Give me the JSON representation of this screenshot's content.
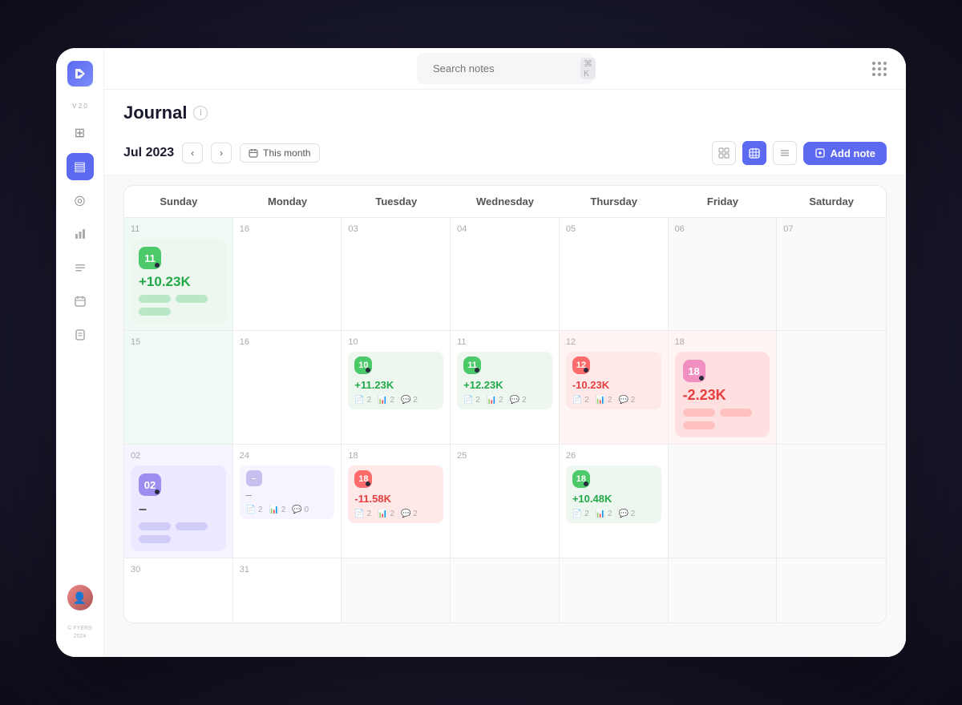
{
  "app": {
    "title": "Journal",
    "logo_letter": "D",
    "version": "V 2.0",
    "footer": "© FYERS\n2024"
  },
  "topbar": {
    "search_placeholder": "Search notes",
    "shortcut": "⌘ K",
    "grid_icon": "grid-dots"
  },
  "page": {
    "title": "Journal",
    "info_icon": "ⓘ"
  },
  "calendar": {
    "month_label": "Jul 2023",
    "this_month": "This month",
    "view_grid_icon": "⊞",
    "view_cal_icon": "⊟",
    "view_list_icon": "≡",
    "add_note_label": "Add note",
    "days": [
      "Sunday",
      "Monday",
      "Tuesday",
      "Wednesday",
      "Thursday",
      "Friday",
      "Saturday"
    ],
    "weeks": [
      {
        "cells": [
          {
            "day": null,
            "type": "empty"
          },
          {
            "day": null,
            "type": "empty"
          },
          {
            "day": "03",
            "type": "normal"
          },
          {
            "day": "04",
            "type": "normal"
          },
          {
            "day": "05",
            "type": "normal"
          },
          {
            "day": "06",
            "type": "empty"
          },
          {
            "day": "07",
            "type": "empty"
          }
        ]
      }
    ],
    "notes": {
      "week1_sun": {
        "badge": "11",
        "badge_color": "green",
        "value": "+10.23K",
        "value_type": "positive",
        "card_color": "green",
        "tags": [
          "green",
          "green",
          "green"
        ],
        "day": "11"
      },
      "week1_mon": {
        "day": "16",
        "type": "empty"
      },
      "week2_tue": {
        "day": "10",
        "badge": "10",
        "badge_color": "green",
        "value": "+11.23K",
        "value_type": "positive",
        "meta": {
          "docs": "2",
          "chart": "2",
          "comment": "2"
        }
      },
      "week2_wed": {
        "day": "11",
        "badge": "11",
        "badge_color": "green",
        "value": "+12.23K",
        "value_type": "positive",
        "meta": {
          "docs": "2",
          "chart": "2",
          "comment": "2"
        }
      },
      "week2_thu": {
        "day": "12",
        "badge": "12",
        "badge_color": "red",
        "value": "-10.23K",
        "value_type": "negative",
        "meta": {
          "docs": "2",
          "chart": "2",
          "comment": "2"
        },
        "card_color": "red-light"
      },
      "week2_fri": {
        "day": "18",
        "badge": "18",
        "badge_color": "pink",
        "value": "-2.23K",
        "value_type": "negative",
        "tags": [
          "red",
          "red",
          "red"
        ],
        "card_color": "red-light",
        "featured": true
      },
      "week3_tue": {
        "day": "18",
        "badge": "18",
        "badge_color": "red",
        "value": "-11.58K",
        "value_type": "negative",
        "meta": {
          "docs": "2",
          "chart": "2",
          "comment": "2"
        }
      },
      "week3_thu": {
        "day": "18",
        "badge": "18",
        "badge_color": "green",
        "value": "+10.48K",
        "value_type": "positive",
        "meta": {
          "docs": "2",
          "chart": "2",
          "comment": "2"
        }
      },
      "week4_sun": {
        "day": "02",
        "badge": "02",
        "badge_color": "purple",
        "value": "–",
        "value_type": "neutral",
        "card_color": "purple-light",
        "tags": [
          "purple",
          "purple",
          "purple"
        ]
      },
      "week4_mon": {
        "day": "24",
        "small_value": "–",
        "meta": {
          "docs": "2",
          "chart": "2",
          "comment": "0"
        }
      }
    }
  },
  "sidebar": {
    "icons": [
      {
        "name": "dashboard-icon",
        "symbol": "⊞",
        "active": false
      },
      {
        "name": "journal-icon",
        "symbol": "▤",
        "active": true
      },
      {
        "name": "portfolio-icon",
        "symbol": "⊙",
        "active": false
      },
      {
        "name": "analytics-icon",
        "symbol": "📊",
        "active": false
      },
      {
        "name": "notes-icon",
        "symbol": "≡",
        "active": false
      },
      {
        "name": "calendar-icon",
        "symbol": "▦",
        "active": false
      },
      {
        "name": "document-icon",
        "symbol": "📄",
        "active": false
      }
    ]
  }
}
